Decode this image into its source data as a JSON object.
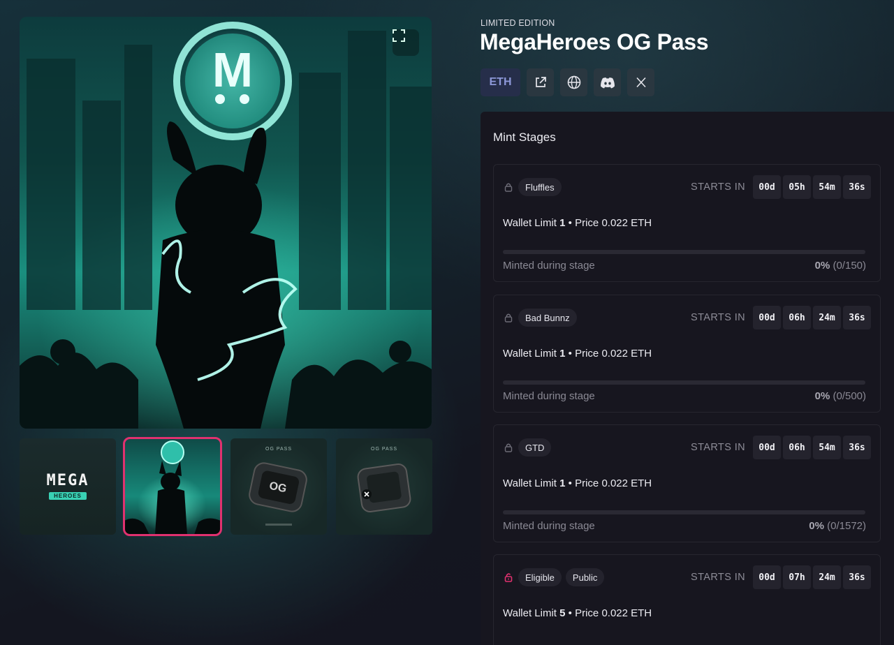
{
  "collection": {
    "eyebrow": "LIMITED EDITION",
    "title": "MegaHeroes OG Pass",
    "chain": "ETH",
    "links": [
      {
        "name": "external-link-icon"
      },
      {
        "name": "globe-icon"
      },
      {
        "name": "discord-icon"
      },
      {
        "name": "x-icon"
      }
    ]
  },
  "media": {
    "hero_letter": "M",
    "selected_thumb": 1,
    "thumbs": [
      {
        "name": "mega-heroes-logo",
        "logo_text": "MEGA",
        "logo_sub": "HEROES"
      },
      {
        "name": "bunny-artwork"
      },
      {
        "name": "og-pass-front",
        "label": "OG PASS"
      },
      {
        "name": "og-pass-back",
        "label": "OG PASS"
      }
    ]
  },
  "mint": {
    "title": "Mint Stages",
    "starts_label": "STARTS IN",
    "wallet_label": "Wallet Limit",
    "price_label": "Price",
    "minted_label": "Minted during stage",
    "stages": [
      {
        "tags": [
          "Fluffles"
        ],
        "eligible": false,
        "countdown": [
          "00d",
          "05h",
          "54m",
          "36s"
        ],
        "wallet_limit": "1",
        "price": "0.022 ETH",
        "percent_text": "0%",
        "count_text": "(0/150)",
        "progress": 0
      },
      {
        "tags": [
          "Bad Bunnz"
        ],
        "eligible": false,
        "countdown": [
          "00d",
          "06h",
          "24m",
          "36s"
        ],
        "wallet_limit": "1",
        "price": "0.022 ETH",
        "percent_text": "0%",
        "count_text": "(0/500)",
        "progress": 0
      },
      {
        "tags": [
          "GTD"
        ],
        "eligible": false,
        "countdown": [
          "00d",
          "06h",
          "54m",
          "36s"
        ],
        "wallet_limit": "1",
        "price": "0.022 ETH",
        "percent_text": "0%",
        "count_text": "(0/1572)",
        "progress": 0
      },
      {
        "tags": [
          "Eligible",
          "Public"
        ],
        "eligible": true,
        "countdown": [
          "00d",
          "07h",
          "24m",
          "36s"
        ],
        "wallet_limit": "5",
        "price": "0.022 ETH",
        "percent_text": "",
        "count_text": "",
        "progress": 0
      }
    ]
  },
  "colors": {
    "accent": "#e0316f",
    "teal": "#39d1b4",
    "panel": "#17161f"
  }
}
